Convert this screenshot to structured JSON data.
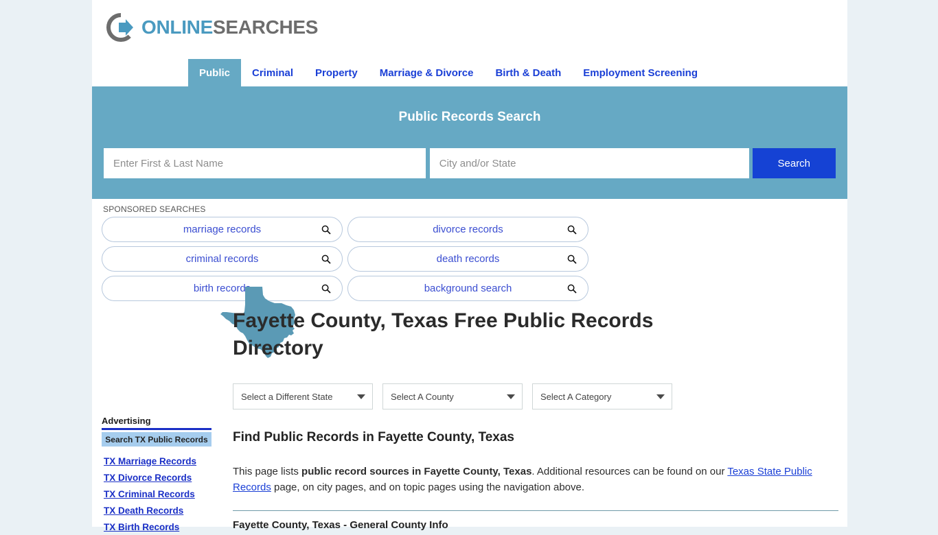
{
  "brand": {
    "name_part1": "ONLINE",
    "name_part2": "SEARCHES",
    "logo_icon": "circle-arrow-right-icon",
    "accent_blue": "#4a9ac0",
    "accent_gray": "#6d6d6d"
  },
  "nav": {
    "tabs": [
      {
        "label": "Public",
        "active": true
      },
      {
        "label": "Criminal",
        "active": false
      },
      {
        "label": "Property",
        "active": false
      },
      {
        "label": "Marriage & Divorce",
        "active": false
      },
      {
        "label": "Birth & Death",
        "active": false
      },
      {
        "label": "Employment Screening",
        "active": false
      }
    ]
  },
  "banner": {
    "title": "Public Records Search",
    "name_placeholder": "Enter First & Last Name",
    "name_value": "",
    "city_placeholder": "City and/or State",
    "city_value": "",
    "search_label": "Search",
    "bg_color": "#66a9c4",
    "button_color": "#1542d4"
  },
  "sponsored": {
    "label": "SPONSORED SEARCHES",
    "pills": [
      {
        "label": "marriage records",
        "icon": "search-icon"
      },
      {
        "label": "divorce records",
        "icon": "search-icon"
      },
      {
        "label": "criminal records",
        "icon": "search-icon"
      },
      {
        "label": "death records",
        "icon": "search-icon"
      },
      {
        "label": "birth records",
        "icon": "search-icon"
      },
      {
        "label": "background search",
        "icon": "search-icon"
      }
    ]
  },
  "hero": {
    "state_icon": "texas-state-outline-icon",
    "title": "Fayette County, Texas Free Public Records Directory"
  },
  "selects": {
    "state": "Select a Different State",
    "county": "Select A County",
    "category": "Select A Category"
  },
  "sidebar": {
    "ad_label": "Advertising",
    "ad_box_label": "Search TX Public Records",
    "links": [
      "TX Marriage Records",
      "TX Divorce Records",
      "TX Criminal Records",
      "TX Death Records",
      "TX Birth Records"
    ]
  },
  "main": {
    "heading": "Find Public Records in Fayette County, Texas",
    "intro_lead": "This page lists ",
    "intro_bold": "public record sources in Fayette County, Texas",
    "intro_mid": ". Additional resources can be found on our ",
    "intro_link": "Texas State Public Records",
    "intro_tail": " page, on city pages, and on topic pages using the navigation above.",
    "section_heading": "Fayette County, Texas - General County Info"
  }
}
